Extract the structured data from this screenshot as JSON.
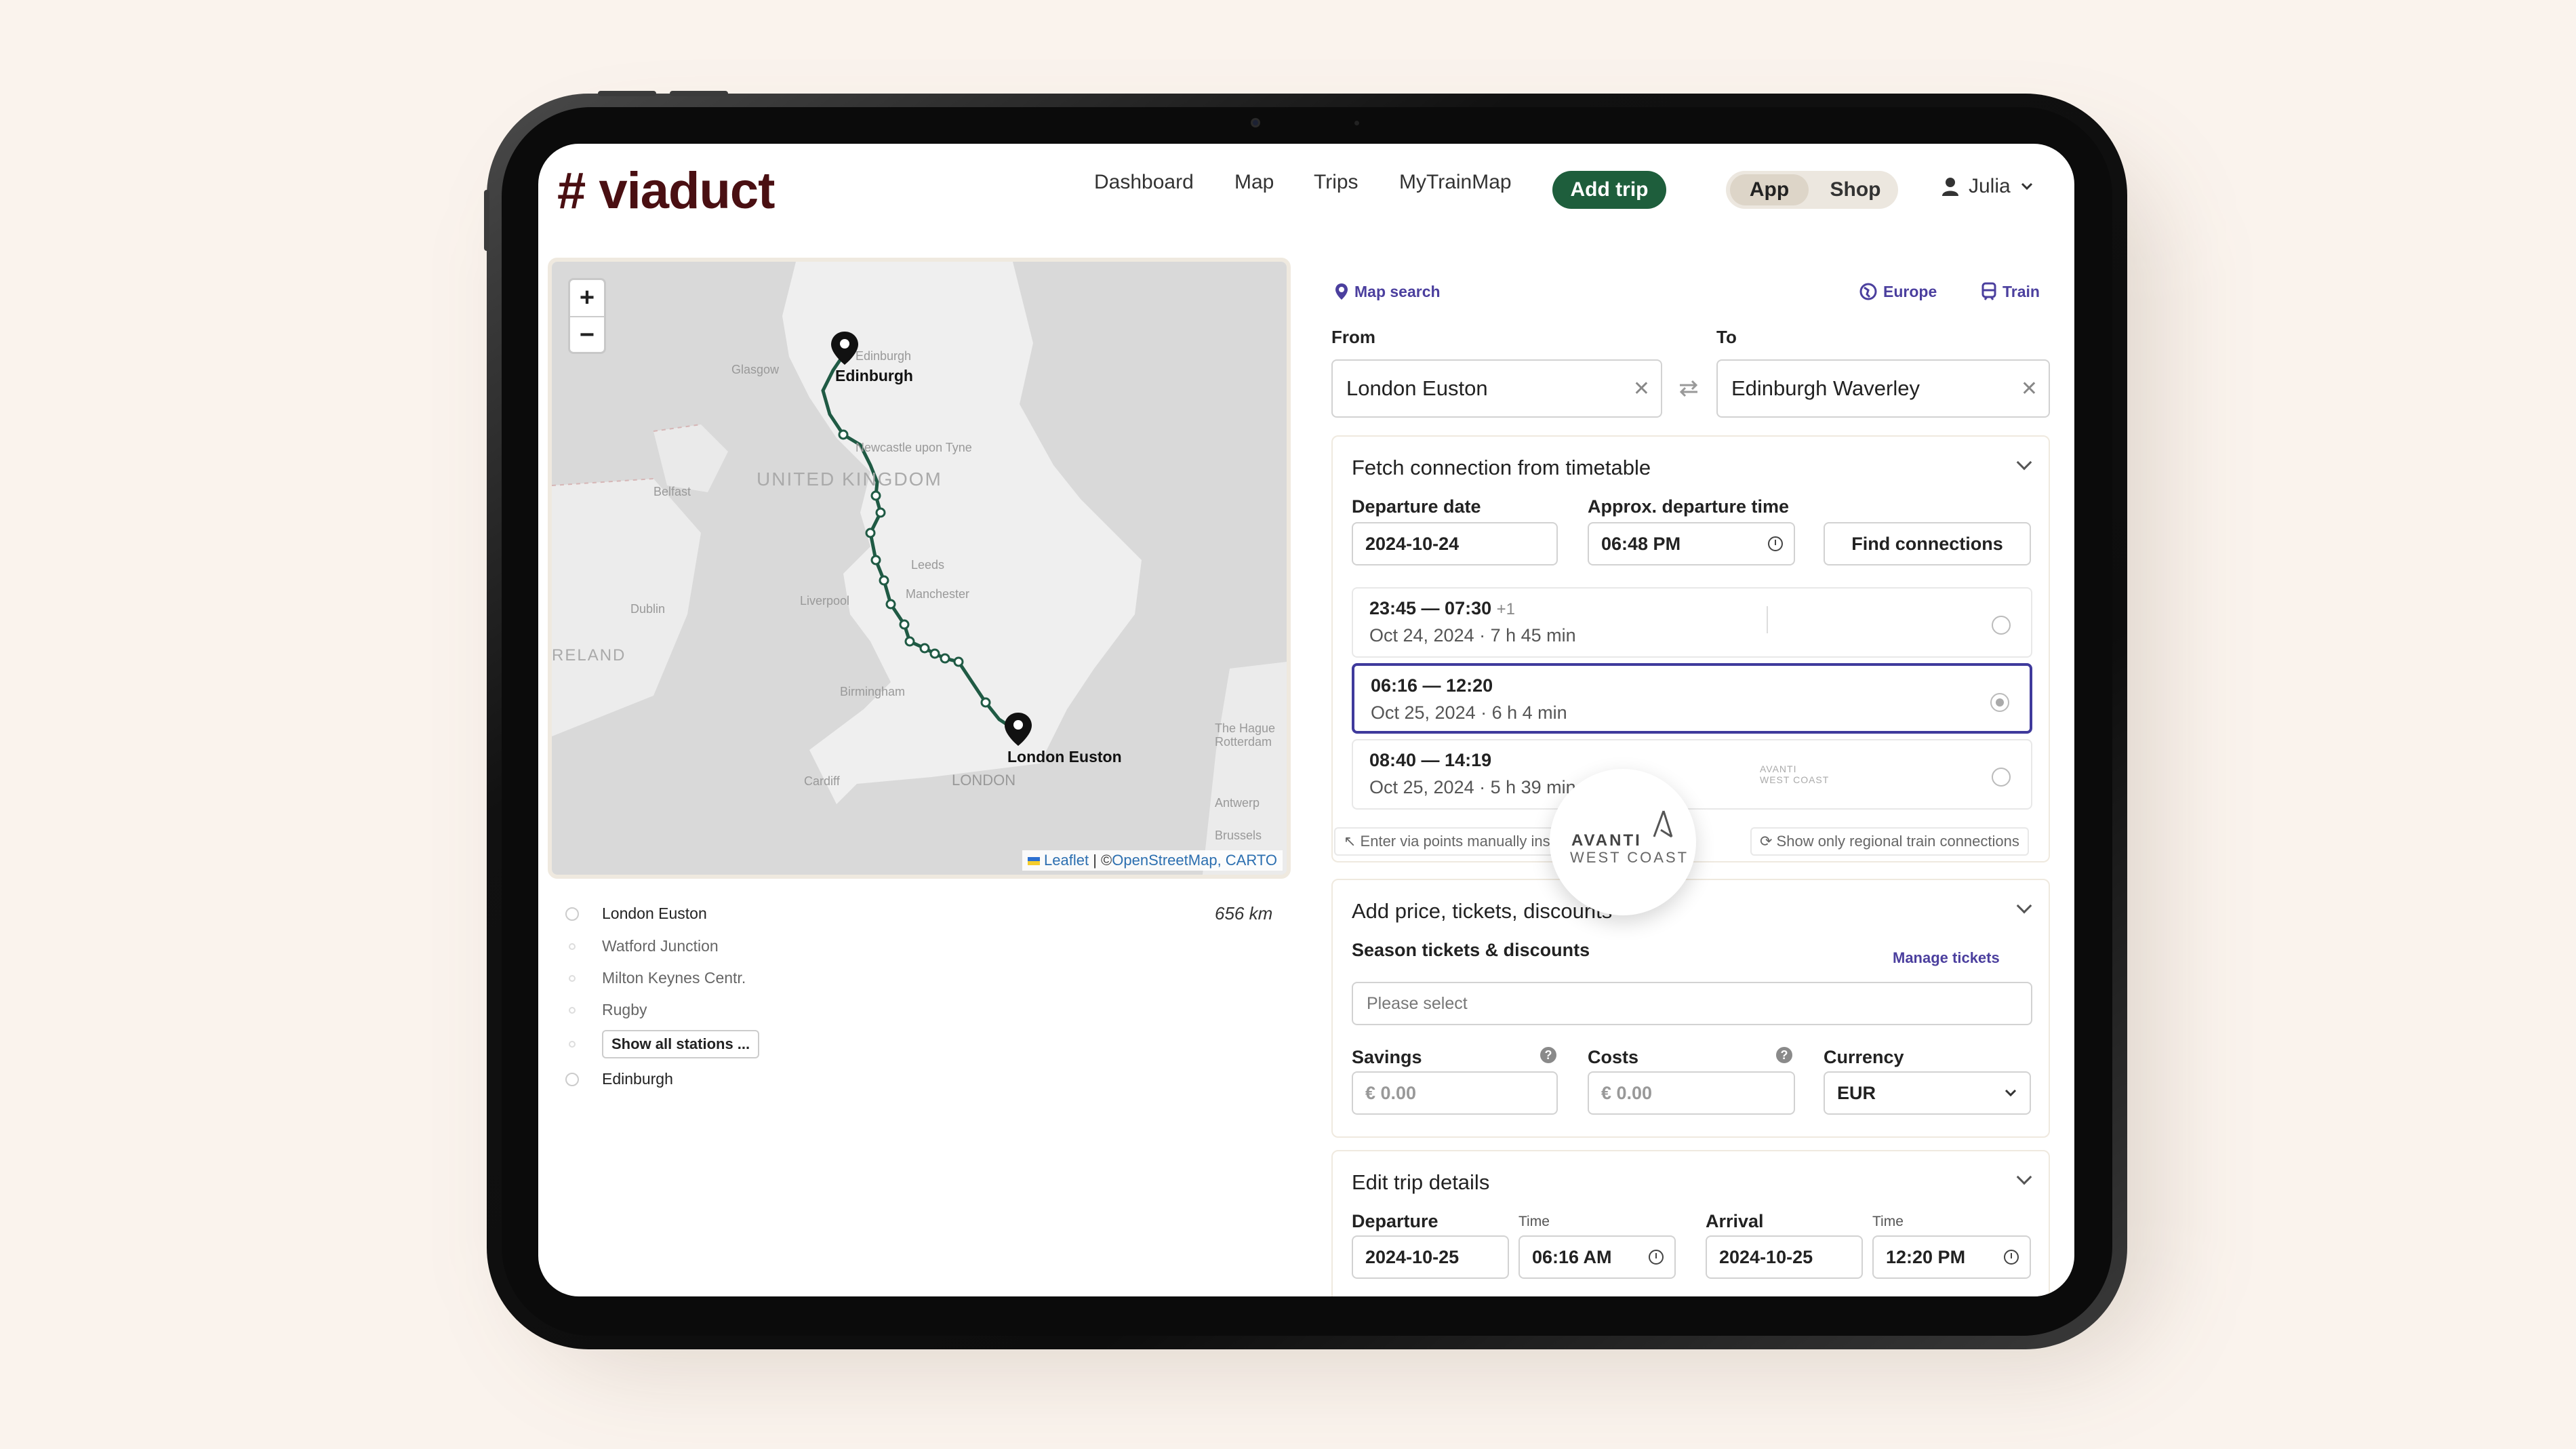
{
  "app": {
    "logo": "# viaduct",
    "nav": [
      "Dashboard",
      "Map",
      "Trips",
      "MyTrainMap"
    ],
    "add_trip": "Add trip",
    "toggle": {
      "app": "App",
      "shop": "Shop"
    },
    "user": "Julia"
  },
  "map": {
    "zoom_in": "+",
    "zoom_out": "−",
    "labels": {
      "edinburgh_marker": "Edinburgh",
      "london_marker": "London Euston",
      "edinburgh_bg": "Edinburgh",
      "glasgow": "Glasgow",
      "newcastle": "Newcastle upon Tyne",
      "uk": "UNITED KINGDOM",
      "belfast": "Belfast",
      "leeds": "Leeds",
      "liverpool": "Liverpool",
      "manchester": "Manchester",
      "dublin": "Dublin",
      "ireland": "RELAND",
      "birmingham": "Birmingham",
      "cardiff": "Cardiff",
      "london_bg": "LONDON",
      "hague": "The Hague",
      "rotterdam": "Rotterdam",
      "antwerp": "Antwerp",
      "brussels": "Brussels"
    },
    "attribution": {
      "leaflet": "Leaflet",
      "sep": " | ©",
      "osm": "OpenStreetMap",
      "carto": ", CARTO"
    }
  },
  "stations": {
    "items": [
      "London Euston",
      "Watford Junction",
      "Milton Keynes Centr.",
      "Rugby"
    ],
    "show_all": "Show all stations ...",
    "last": "Edinburgh",
    "distance": "656 km"
  },
  "search": {
    "map_search": "Map search",
    "region": "Europe",
    "mode": "Train",
    "from_label": "From",
    "from_value": "London Euston",
    "to_label": "To",
    "to_value": "Edinburgh Waverley"
  },
  "timetable": {
    "title": "Fetch connection from timetable",
    "date_label": "Departure date",
    "date_value": "2024-10-24",
    "time_label": "Approx. departure time",
    "time_value": "06:48 PM",
    "find": "Find connections",
    "connections": [
      {
        "time": "23:45 — 07:30",
        "plus": "+1",
        "date": "Oct 24, 2024",
        "duration": "7 h 45 min",
        "selected": false
      },
      {
        "time": "06:16 — 12:20",
        "plus": "",
        "date": "Oct 25, 2024",
        "duration": "6 h 4 min",
        "selected": true
      },
      {
        "time": "08:40 — 14:19",
        "plus": "",
        "date": "Oct 25, 2024",
        "duration": "5 h 39 min",
        "selected": false
      }
    ],
    "operator_line1": "AVANTI",
    "operator_line2": "WEST COAST",
    "manual": "Enter via points manually instead",
    "regional": "Show only regional train connections"
  },
  "price": {
    "title": "Add price, tickets, discounts",
    "season_label": "Season tickets & discounts",
    "manage": "Manage tickets",
    "placeholder": "Please select",
    "savings_label": "Savings",
    "savings_value": "€  0.00",
    "costs_label": "Costs",
    "costs_value": "€  0.00",
    "currency_label": "Currency",
    "currency_value": "EUR"
  },
  "details": {
    "title": "Edit trip details",
    "departure_label": "Departure",
    "departure_date": "2024-10-25",
    "time_label": "Time",
    "departure_time": "06:16 AM",
    "arrival_label": "Arrival",
    "arrival_date": "2024-10-25",
    "arrival_time": "12:20 PM"
  },
  "colors": {
    "brand": "#4a0f12",
    "accent": "#1e5e3c",
    "highlight": "#3f3a9c",
    "route": "#1f5a44"
  }
}
